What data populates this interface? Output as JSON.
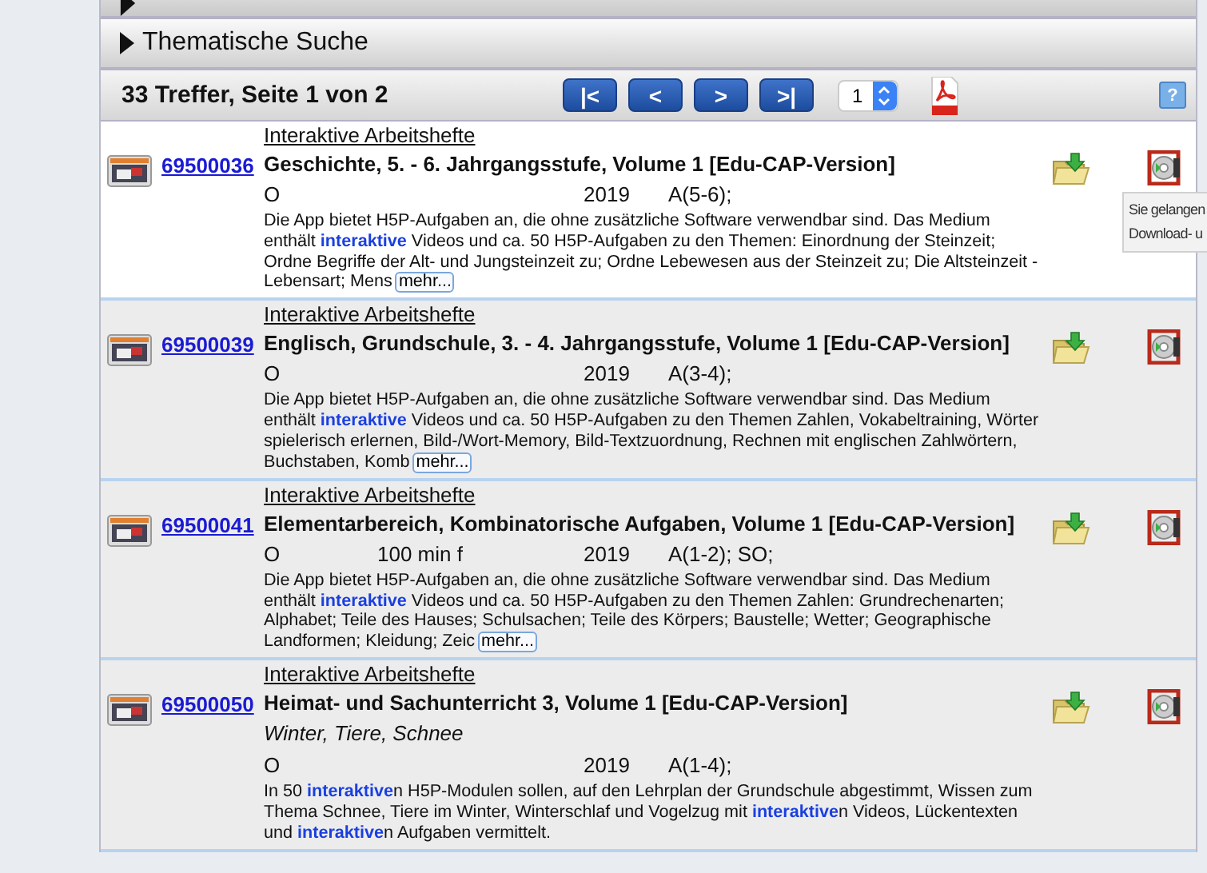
{
  "sections": [
    {
      "label": "Thematische Suche",
      "expanded": false
    }
  ],
  "results_bar": {
    "summary": "33 Treffer, Seite 1 von 2",
    "nav_buttons": [
      "|<",
      "<",
      ">",
      ">|"
    ],
    "page_select": "1",
    "help": "?"
  },
  "results": [
    {
      "category": "Interaktive Arbeitshefte",
      "id": "69500036",
      "title": "Geschichte, 5. - 6. Jahrgangsstufe, Volume 1 [Edu-CAP-Version]",
      "format": "O",
      "year": "2019",
      "audience": "A(5-6);",
      "description": "Die App bietet H5P-Aufgaben an, die ohne zusätzliche Software verwendbar sind. Das Medium enthält **interaktive** Videos und ca. 50 H5P-Aufgaben zu den Themen: Einordnung der Steinzeit; Ordne Begriffe der Alt- und Jungsteinzeit zu; Ordne Lebewesen aus der Steinzeit zu; Die Altsteinzeit - Lebensart; Mens",
      "more": "mehr...",
      "hovered": true
    },
    {
      "category": "Interaktive Arbeitshefte",
      "id": "69500039",
      "title": "Englisch, Grundschule, 3. - 4. Jahrgangsstufe, Volume 1 [Edu-CAP-Version]",
      "format": "O",
      "year": "2019",
      "audience": "A(3-4);",
      "description": "Die App bietet H5P-Aufgaben an, die ohne zusätzliche Software verwendbar sind. Das Medium enthält **interaktive** Videos und ca. 50 H5P-Aufgaben zu den Themen Zahlen, Vokabeltraining, Wörter spielerisch erlernen, Bild-/Wort-Memory, Bild-Textzuordnung, Rechnen mit englischen Zahlwörtern, Buchstaben, Komb",
      "more": "mehr...",
      "hovered": false
    },
    {
      "category": "Interaktive Arbeitshefte",
      "id": "69500041",
      "title": "Elementarbereich, Kombinatorische Aufgaben, Volume 1 [Edu-CAP-Version]",
      "format": "O",
      "duration": "100 min f",
      "year": "2019",
      "audience": "A(1-2); SO;",
      "description": "Die App bietet H5P-Aufgaben an, die ohne zusätzliche Software verwendbar sind. Das Medium enthält **interaktive** Videos und ca. 50 H5P-Aufgaben zu den Themen Zahlen: Grundrechenarten; Alphabet; Teile des Hauses; Schulsachen; Teile des Körpers; Baustelle; Wetter; Geographische Landformen; Kleidung; Zeic",
      "more": "mehr...",
      "hovered": false
    },
    {
      "category": "Interaktive Arbeitshefte",
      "id": "69500050",
      "title": "Heimat- und Sachunterricht 3, Volume 1 [Edu-CAP-Version]",
      "subtitle": "Winter, Tiere, Schnee",
      "format": "O",
      "year": "2019",
      "audience": "A(1-4);",
      "description": "In 50 **interaktive**n H5P-Modulen sollen, auf den Lehrplan der Grundschule abgestimmt, Wissen zum Thema Schnee, Tiere im Winter, Winterschlaf und Vogelzug mit **interaktive**n Videos, Lückentexten und **interaktive**n Aufgaben vermittelt.",
      "hovered": false
    }
  ],
  "tooltip": {
    "lines": [
      "Sie gelangen",
      "Download- u"
    ]
  }
}
